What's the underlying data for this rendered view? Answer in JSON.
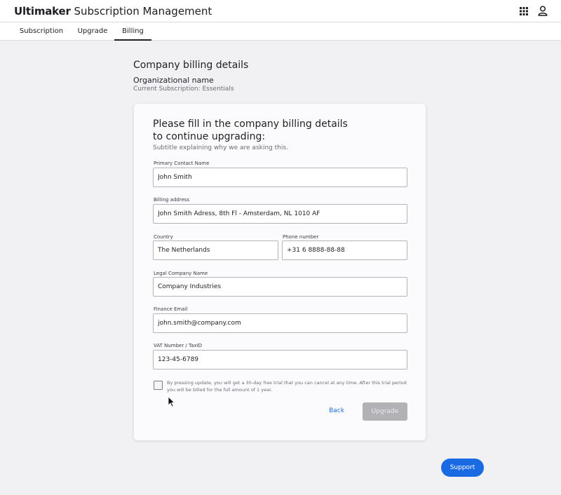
{
  "app": {
    "brand_bold": "Ultimaker",
    "brand_rest": " Subscription Management"
  },
  "tabs": [
    {
      "label": "Subscription"
    },
    {
      "label": "Upgrade"
    },
    {
      "label": "Billing",
      "active": true
    }
  ],
  "page": {
    "title": "Company billing details",
    "org_name": "Organizational name",
    "subscription": "Current Subscription: Essentials"
  },
  "form": {
    "heading": "Please fill in the company billing details to continue upgrading:",
    "subtitle": "Subtitle explaining why we are asking this.",
    "fields": {
      "contact_name": {
        "label": "Primary Contact Name",
        "value": "John Smith"
      },
      "billing_address": {
        "label": "Billing address",
        "value": "John Smith Adress, 8th Fl - Amsterdam, NL 1010 AF"
      },
      "country": {
        "label": "Country",
        "value": "The Netherlands"
      },
      "phone": {
        "label": "Phone number",
        "value": "+31 6 8888-88-88"
      },
      "company_name": {
        "label": "Legal Company Name",
        "value": "Company Industries"
      },
      "finance_email": {
        "label": "Finance Email",
        "value": "john.smith@company.com"
      },
      "vat": {
        "label": "VAT Number / TaxID",
        "value": "123-45-6789"
      }
    },
    "terms_checked": false,
    "terms_text": "By pressing update, you will get a 30-day free trial that you can cancel at any time. After this trial period you will be billed for the full amount of 1 year.",
    "back_label": "Back",
    "upgrade_label": "Upgrade"
  },
  "support_label": "Support",
  "colors": {
    "accent": "#1a6ae4",
    "link": "#1b6ce0",
    "disabled_button": "#b1b1b6",
    "background": "#f1f0f3"
  },
  "icons": {
    "apps": "apps-grid-icon",
    "user": "user-icon",
    "cursor": "mouse-cursor-icon"
  }
}
